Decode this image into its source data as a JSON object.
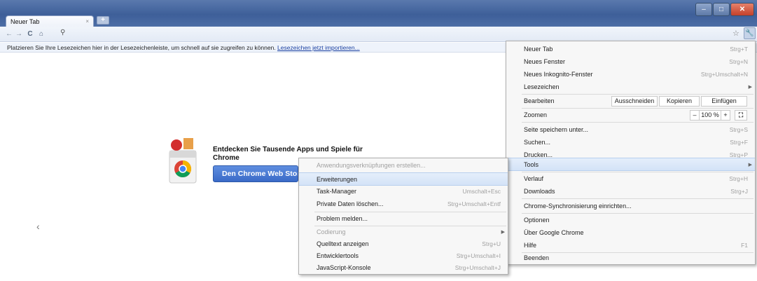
{
  "window": {
    "tab_title": "Neuer Tab",
    "tab_close": "×",
    "new_tab": "+",
    "min": "–",
    "max": "□",
    "close": "✕"
  },
  "toolbar": {
    "back_icon": "←",
    "forward_icon": "→",
    "reload_icon": "C",
    "home_icon": "⌂",
    "search_icon": "⚲",
    "star_icon": "☆",
    "wrench_icon": "🔧"
  },
  "bookmarks": {
    "text": "Platzieren Sie Ihre Lesezeichen hier in der Lesezeichenleiste, um schnell auf sie zugreifen zu können.",
    "link": "Lesezeichen jetzt importieren..."
  },
  "promo": {
    "title": "Entdecken Sie Tausende Apps und Spiele für Chrome",
    "button": "Den Chrome Web Store"
  },
  "ntp": {
    "prev_arrow": "‹"
  },
  "main_menu": {
    "new_tab": "Neuer Tab",
    "new_tab_acc": "Strg+T",
    "new_window": "Neues Fenster",
    "new_window_acc": "Strg+N",
    "incognito": "Neues Inkognito-Fenster",
    "incognito_acc": "Strg+Umschalt+N",
    "bookmarks": "Lesezeichen",
    "edit": "Bearbeiten",
    "cut": "Ausschneiden",
    "copy": "Kopieren",
    "paste": "Einfügen",
    "zoom": "Zoomen",
    "zoom_minus": "–",
    "zoom_value": "100 %",
    "zoom_plus": "+",
    "fullscreen_icon": "⛶",
    "save_page": "Seite speichern unter...",
    "save_page_acc": "Strg+S",
    "find": "Suchen...",
    "find_acc": "Strg+F",
    "print": "Drucken...",
    "print_acc": "Strg+P",
    "tools": "Tools",
    "history": "Verlauf",
    "history_acc": "Strg+H",
    "downloads": "Downloads",
    "downloads_acc": "Strg+J",
    "sync": "Chrome-Synchronisierung einrichten...",
    "options": "Optionen",
    "about": "Über Google Chrome",
    "help": "Hilfe",
    "help_acc": "F1",
    "exit": "Beenden"
  },
  "tools_menu": {
    "app_shortcuts": "Anwendungsverknüpfungen erstellen...",
    "extensions": "Erweiterungen",
    "task_manager": "Task-Manager",
    "task_manager_acc": "Umschalt+Esc",
    "clear_data": "Private Daten löschen...",
    "clear_data_acc": "Strg+Umschalt+Entf",
    "report": "Problem melden...",
    "encoding": "Codierung",
    "view_source": "Quelltext anzeigen",
    "view_source_acc": "Strg+U",
    "dev_tools": "Entwicklertools",
    "dev_tools_acc": "Strg+Umschalt+I",
    "js_console": "JavaScript-Konsole",
    "js_console_acc": "Strg+Umschalt+J"
  },
  "colors": {
    "titlebar": "#3e5f99",
    "highlight": "#d4e3f7",
    "store_button": "#3a6ac7",
    "close_button": "#c3402a"
  }
}
